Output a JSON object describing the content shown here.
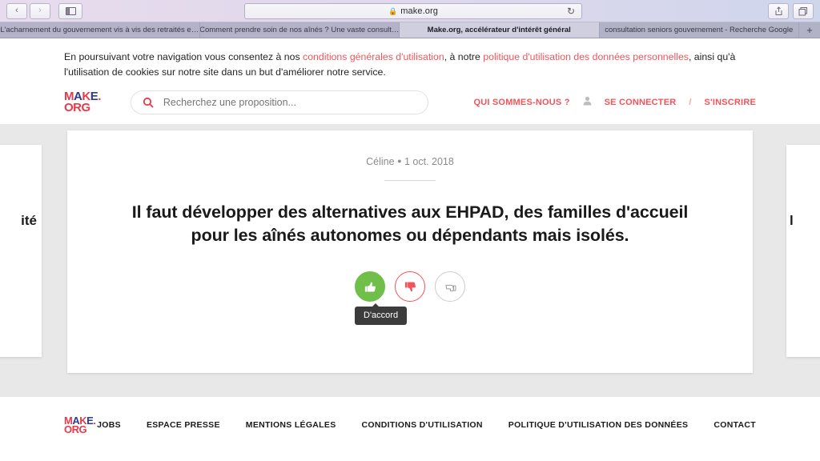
{
  "browser": {
    "back_label": "‹",
    "forward_label": "›",
    "sidebar_icon": "sidebar-icon",
    "url": "make.org",
    "lock_icon": "lock-icon",
    "reload_icon": "reload-icon",
    "share_icon": "share-icon",
    "tabs_overview_icon": "tabs-overview-icon",
    "new_tab_label": "+",
    "tabs": [
      {
        "title": "L'acharnement du gouvernement vis à vis des retraités e…",
        "active": false
      },
      {
        "title": "Comment prendre soin de nos aînés ? Une vaste consult…",
        "active": false
      },
      {
        "title": "Make.org, accélérateur d'intérêt général",
        "active": true
      },
      {
        "title": "consultation seniors gouvernement - Recherche Google",
        "active": false
      }
    ]
  },
  "cookie_banner": {
    "part1": "En poursuivant votre navigation vous consentez à nos ",
    "link1": "conditions générales d'utilisation",
    "part2": ", à notre ",
    "link2": "politique d'utilisation des données personnelles",
    "part3": ", ainsi qu'à l'utilisation de cookies sur notre site dans un but d'améliorer notre service.",
    "close_label": "✕",
    "link_color": "#f2545b"
  },
  "header": {
    "logo": {
      "m": "M",
      "a": "A",
      "k": "K",
      "e": "E",
      "dot": ".",
      "org": "ORG",
      "red": "#e8394a",
      "blue": "#2c3b8f"
    },
    "search": {
      "placeholder": "Recherchez une proposition...",
      "value": "",
      "icon": "search-icon"
    },
    "about_label": "QUI SOMMES-NOUS ?",
    "user_icon": "user-icon",
    "login_label": "SE CONNECTER",
    "separator": "/",
    "signup_label": "S'INSCRIRE"
  },
  "main": {
    "card": {
      "author": "Céline",
      "bullet": "●",
      "date": "1 oct. 2018",
      "proposal": "Il faut développer des alternatives aux EHPAD, des familles d'accueil pour les aînés autonomes ou dépendants mais isolés."
    },
    "side_left_fragment": "ité",
    "side_right_fragment": "l",
    "votes": {
      "agree": {
        "icon": "thumbs-up-icon",
        "label": "D'accord",
        "color": "#6fbf4a",
        "state": "selected"
      },
      "disagree": {
        "icon": "thumbs-down-icon",
        "label": "Pas d'accord",
        "color": "#f2545b",
        "state": "default"
      },
      "neutral": {
        "icon": "neutral-hand-icon",
        "label": "Je passe",
        "color": "#cccccc",
        "state": "default"
      }
    },
    "tooltip_text": "D'accord"
  },
  "footer": {
    "logo": {
      "m": "M",
      "a": "A",
      "k": "K",
      "e": "E",
      "dot": ".",
      "org": "ORG"
    },
    "links": [
      "JOBS",
      "ESPACE PRESSE",
      "MENTIONS LÉGALES",
      "CONDITIONS D'UTILISATION",
      "POLITIQUE D'UTILISATION DES DONNÉES",
      "CONTACT"
    ]
  }
}
